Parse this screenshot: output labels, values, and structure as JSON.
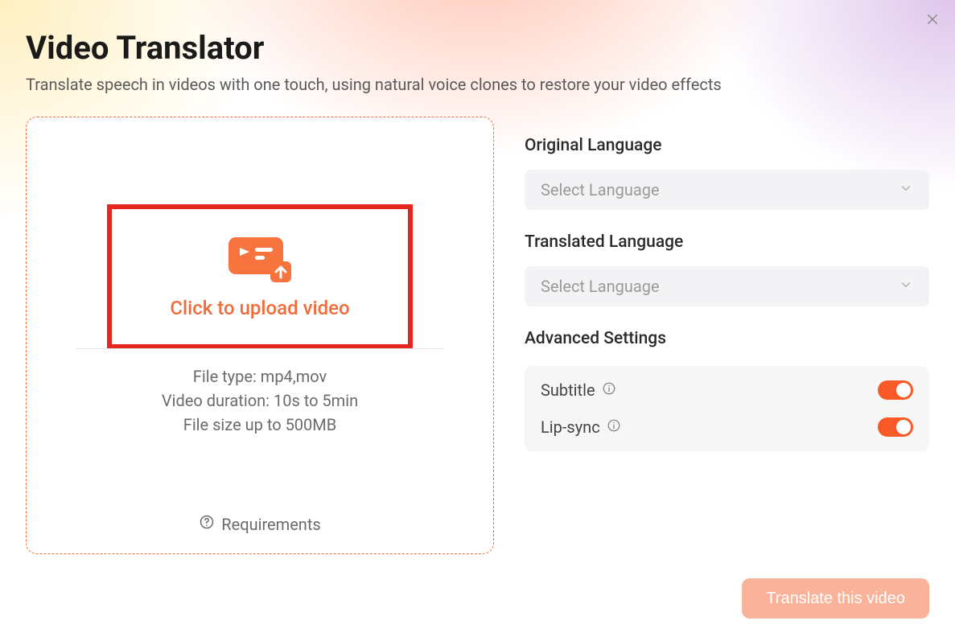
{
  "header": {
    "title": "Video Translator",
    "subtitle": "Translate speech in videos with one touch, using natural voice clones to restore your video effects"
  },
  "upload": {
    "cta": "Click to upload video",
    "file_type": "File type: mp4,mov",
    "duration": "Video duration: 10s to 5min",
    "size": "File size up to  500MB",
    "requirements_label": "Requirements"
  },
  "settings": {
    "original_label": "Original Language",
    "original_placeholder": "Select Language",
    "translated_label": "Translated Language",
    "translated_placeholder": "Select Language",
    "advanced_label": "Advanced Settings",
    "subtitle_label": "Subtitle",
    "lipsync_label": "Lip-sync"
  },
  "footer": {
    "translate_label": "Translate this video"
  }
}
